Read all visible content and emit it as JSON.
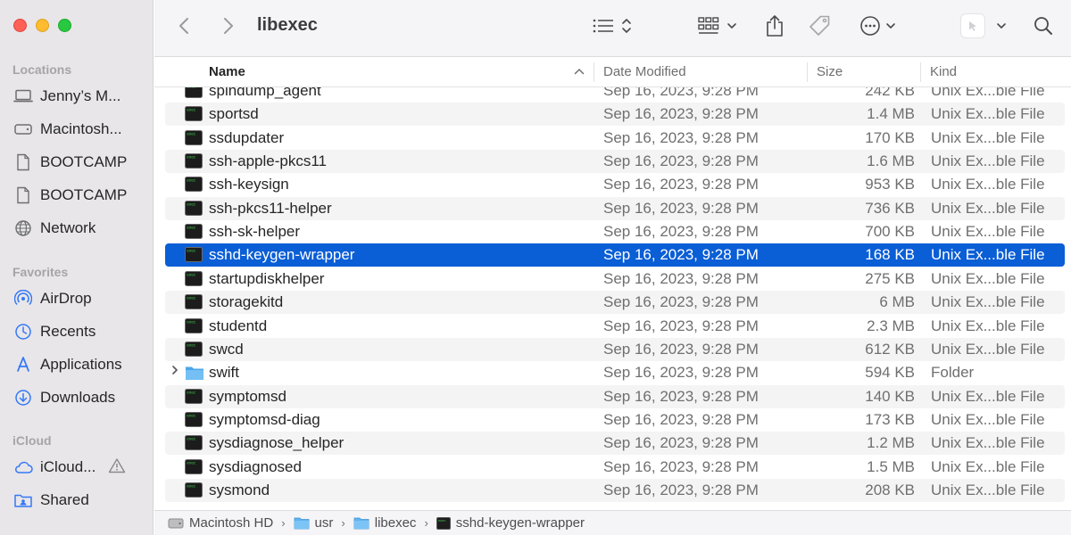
{
  "window": {
    "title": "libexec"
  },
  "sidebar": {
    "sections": [
      {
        "heading": "Locations",
        "items": [
          {
            "label": "Jenny’s M...",
            "icon": "laptop-icon"
          },
          {
            "label": "Macintosh...",
            "icon": "disk-icon"
          },
          {
            "label": "BOOTCAMP",
            "icon": "document-icon"
          },
          {
            "label": "BOOTCAMP",
            "icon": "document-icon"
          },
          {
            "label": "Network",
            "icon": "globe-icon"
          }
        ]
      },
      {
        "heading": "Favorites",
        "items": [
          {
            "label": "AirDrop",
            "icon": "airdrop-icon"
          },
          {
            "label": "Recents",
            "icon": "clock-icon"
          },
          {
            "label": "Applications",
            "icon": "applications-icon"
          },
          {
            "label": "Downloads",
            "icon": "download-icon"
          }
        ]
      },
      {
        "heading": "iCloud",
        "items": [
          {
            "label": "iCloud...",
            "icon": "cloud-icon",
            "warning": true
          },
          {
            "label": "Shared",
            "icon": "shared-folder-icon"
          }
        ]
      }
    ]
  },
  "columns": {
    "name": "Name",
    "date": "Date Modified",
    "size": "Size",
    "kind": "Kind"
  },
  "files": [
    {
      "name": "spindump_agent",
      "date": "Sep 16, 2023, 9:28 PM",
      "size": "242 KB",
      "kind": "Unix Ex...ble File",
      "type": "exec"
    },
    {
      "name": "sportsd",
      "date": "Sep 16, 2023, 9:28 PM",
      "size": "1.4 MB",
      "kind": "Unix Ex...ble File",
      "type": "exec"
    },
    {
      "name": "ssdupdater",
      "date": "Sep 16, 2023, 9:28 PM",
      "size": "170 KB",
      "kind": "Unix Ex...ble File",
      "type": "exec"
    },
    {
      "name": "ssh-apple-pkcs11",
      "date": "Sep 16, 2023, 9:28 PM",
      "size": "1.6 MB",
      "kind": "Unix Ex...ble File",
      "type": "exec"
    },
    {
      "name": "ssh-keysign",
      "date": "Sep 16, 2023, 9:28 PM",
      "size": "953 KB",
      "kind": "Unix Ex...ble File",
      "type": "exec"
    },
    {
      "name": "ssh-pkcs11-helper",
      "date": "Sep 16, 2023, 9:28 PM",
      "size": "736 KB",
      "kind": "Unix Ex...ble File",
      "type": "exec"
    },
    {
      "name": "ssh-sk-helper",
      "date": "Sep 16, 2023, 9:28 PM",
      "size": "700 KB",
      "kind": "Unix Ex...ble File",
      "type": "exec"
    },
    {
      "name": "sshd-keygen-wrapper",
      "date": "Sep 16, 2023, 9:28 PM",
      "size": "168 KB",
      "kind": "Unix Ex...ble File",
      "type": "exec",
      "selected": true
    },
    {
      "name": "startupdiskhelper",
      "date": "Sep 16, 2023, 9:28 PM",
      "size": "275 KB",
      "kind": "Unix Ex...ble File",
      "type": "exec"
    },
    {
      "name": "storagekitd",
      "date": "Sep 16, 2023, 9:28 PM",
      "size": "6 MB",
      "kind": "Unix Ex...ble File",
      "type": "exec"
    },
    {
      "name": "studentd",
      "date": "Sep 16, 2023, 9:28 PM",
      "size": "2.3 MB",
      "kind": "Unix Ex...ble File",
      "type": "exec"
    },
    {
      "name": "swcd",
      "date": "Sep 16, 2023, 9:28 PM",
      "size": "612 KB",
      "kind": "Unix Ex...ble File",
      "type": "exec"
    },
    {
      "name": "swift",
      "date": "Sep 16, 2023, 9:28 PM",
      "size": "594 KB",
      "kind": "Folder",
      "type": "folder"
    },
    {
      "name": "symptomsd",
      "date": "Sep 16, 2023, 9:28 PM",
      "size": "140 KB",
      "kind": "Unix Ex...ble File",
      "type": "exec"
    },
    {
      "name": "symptomsd-diag",
      "date": "Sep 16, 2023, 9:28 PM",
      "size": "173 KB",
      "kind": "Unix Ex...ble File",
      "type": "exec"
    },
    {
      "name": "sysdiagnose_helper",
      "date": "Sep 16, 2023, 9:28 PM",
      "size": "1.2 MB",
      "kind": "Unix Ex...ble File",
      "type": "exec"
    },
    {
      "name": "sysdiagnosed",
      "date": "Sep 16, 2023, 9:28 PM",
      "size": "1.5 MB",
      "kind": "Unix Ex...ble File",
      "type": "exec"
    },
    {
      "name": "sysmond",
      "date": "Sep 16, 2023, 9:28 PM",
      "size": "208 KB",
      "kind": "Unix Ex...ble File",
      "type": "exec"
    }
  ],
  "pathbar": [
    {
      "label": "Macintosh HD",
      "icon": "disk-icon"
    },
    {
      "label": "usr",
      "icon": "folder-icon"
    },
    {
      "label": "libexec",
      "icon": "folder-icon"
    },
    {
      "label": "sshd-keygen-wrapper",
      "icon": "terminal-exec-icon"
    }
  ],
  "colors": {
    "selection": "#0a5ed6",
    "accent": "#3478f6",
    "folder": "#5fb3f0"
  }
}
